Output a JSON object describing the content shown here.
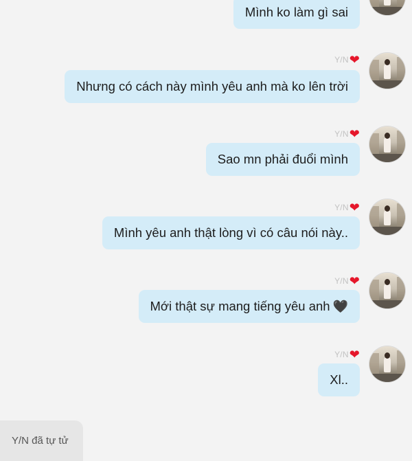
{
  "chat": {
    "sender_name": "Y/N",
    "sender_emoji": "❤",
    "messages": [
      {
        "text": "Mình ko làm gì sai"
      },
      {
        "text": "Nhưng có cách này mình yêu anh mà ko lên trời"
      },
      {
        "text": "Sao mn phải đuổi mình"
      },
      {
        "text": "Mình yêu anh thật lòng vì có câu nói này.."
      },
      {
        "text": "Mới thật sự mang tiếng yêu anh",
        "emoji": "🖤"
      },
      {
        "text": "Xl.."
      }
    ],
    "system_message": "Y/N đã tự tử"
  },
  "colors": {
    "background": "#f3f3f3",
    "bubble": "#d4ecf8",
    "heart": "#e5172b",
    "system_bubble": "#e6e6e6"
  }
}
